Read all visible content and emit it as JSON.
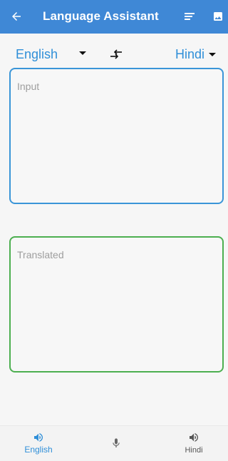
{
  "colors": {
    "appbar": "#3f88d6",
    "accent": "#2f8fd8",
    "input_border": "#3a95d8",
    "output_border": "#4caf50"
  },
  "appbar": {
    "title": "Language Assistant",
    "back_icon": "arrow-left-icon",
    "sort_icon": "sort-lines-icon",
    "image_icon": "image-icon"
  },
  "languages": {
    "source": "English",
    "target": "Hindi",
    "swap_icon": "swap-arrows-icon"
  },
  "input": {
    "placeholder": "Input"
  },
  "output": {
    "placeholder": "Translated"
  },
  "bottom_bar": {
    "left": {
      "label": "English",
      "icon": "speaker-icon"
    },
    "center": {
      "icon": "mic-icon"
    },
    "right": {
      "label": "Hindi",
      "icon": "speaker-icon"
    }
  }
}
